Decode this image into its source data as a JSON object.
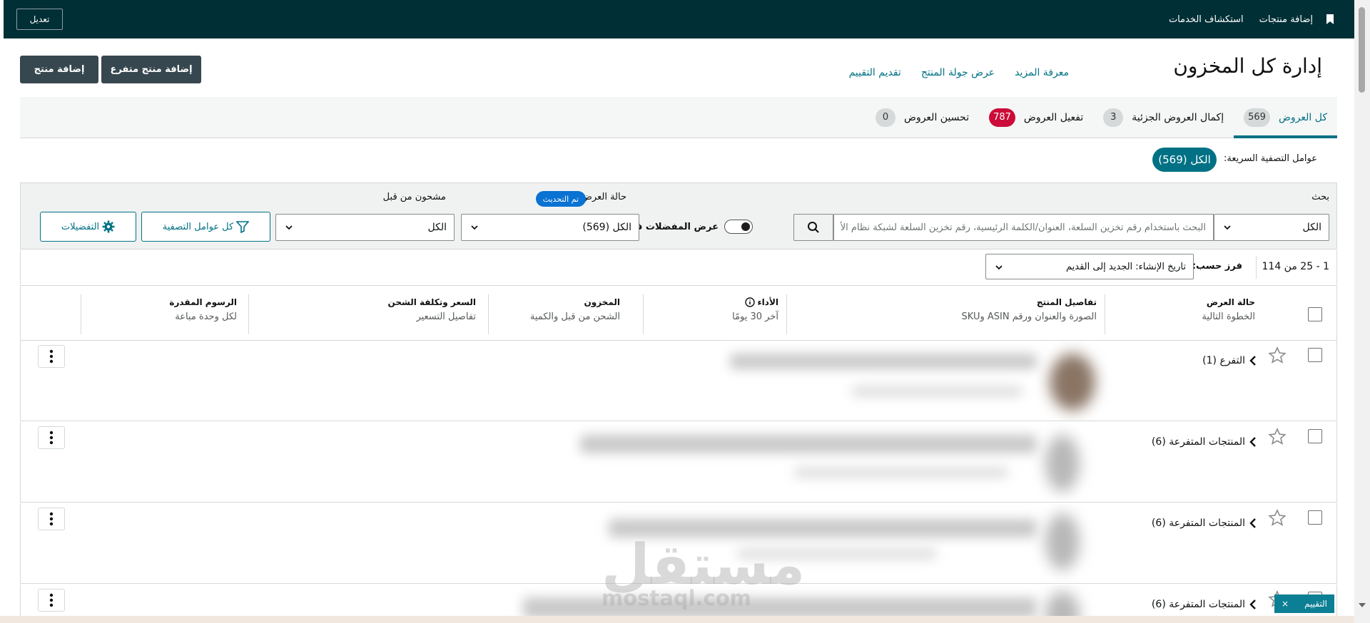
{
  "topbar": {
    "bookmark_icon": "bookmark-icon",
    "add_products": "إضافة منتجات",
    "discover_services": "استكشاف الخدمات",
    "edit": "تعديل"
  },
  "header": {
    "title": "إدارة كل المخزون",
    "learn_more": "معرفة المزيد",
    "product_tour": "عرض جولة المنتج",
    "rate": "تقديم التقييم",
    "add_variation_btn": "إضافة منتج متفرع",
    "add_product_btn": "إضافة منتج"
  },
  "tabs": [
    {
      "label": "كل العروض",
      "count": "569",
      "active": true
    },
    {
      "label": "إكمال العروض الجزئية",
      "count": "3"
    },
    {
      "label": "تفعيل العروض",
      "count": "787",
      "badge_color": "#cc0c39"
    },
    {
      "label": "تحسين العروض",
      "count": "0"
    }
  ],
  "quick_filters": {
    "label": "عوامل التصفية السريعة:",
    "all": "الكل (569)"
  },
  "filters": {
    "search_label": "بحث",
    "search_scope": "الكل",
    "search_placeholder": "البحث باستخدام رقم تخزين السلعة، العنوان/الكلمة الرئيسية، رقم تخزين السلعة لشبكة نظام الأ",
    "favorites_only": "عرض المفضلات فقط",
    "listing_status_label": "حالة العرض",
    "updated_badge": "تم التحديث",
    "listing_status_value": "الكل (569)",
    "shipped_before_label": "مشحون من قبل",
    "shipped_before_value": "الكل",
    "all_filters": "كل عوامل التصفية",
    "preferences": "التفضيلات"
  },
  "results": {
    "count": "1 - 25 من 114",
    "sort_label": "فرز حسب:",
    "sort_value": "تاريخ الإنشاء: الجديد إلى القديم"
  },
  "columns": [
    {
      "title": "حالة العرض",
      "sub": "الخطوة التالية"
    },
    {
      "title": "تفاصيل المنتج",
      "sub": "الصورة والعنوان ورقم ASIN وSKU"
    },
    {
      "title": "الأداء",
      "sub": "آخر 30 يومًا"
    },
    {
      "title": "المخزون",
      "sub": "الشحن من قبل والكمية"
    },
    {
      "title": "السعر وتكلفة الشحن",
      "sub": "تفاصيل التسعير"
    },
    {
      "title": "الرسوم المقدرة",
      "sub": "لكل وحدة مباعة"
    }
  ],
  "rows": [
    {
      "variation_label": "التفرع (1)"
    },
    {
      "variation_label": "المنتجات المتفرعة (6)"
    },
    {
      "variation_label": "المنتجات المتفرعة (6)"
    },
    {
      "variation_label": "المنتجات المتفرعة (6)"
    }
  ],
  "watermark": {
    "text": "مستقل",
    "url": "mostaql.com"
  },
  "feedback_chip": {
    "label": "التقييم",
    "close": "×"
  },
  "colors": {
    "topbar": "#002f36",
    "accent": "#007185",
    "dark_button": "#37474f",
    "alert": "#cc0c39",
    "pill_blue": "#0972d3"
  }
}
